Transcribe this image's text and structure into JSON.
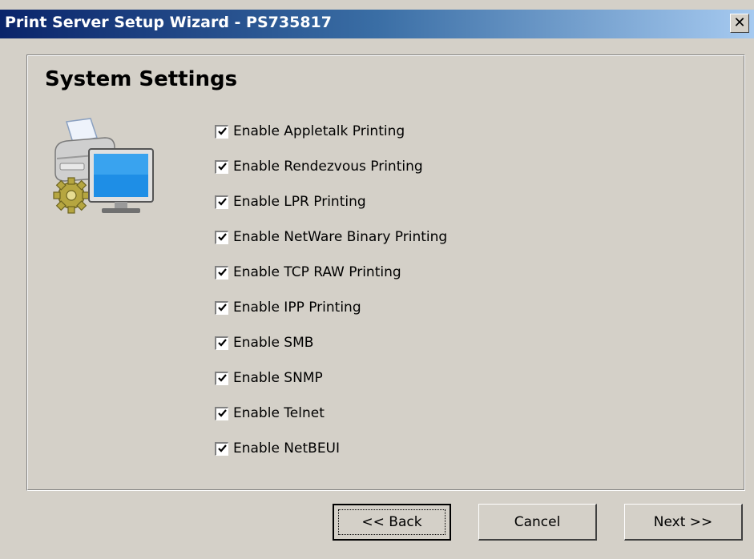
{
  "window": {
    "title": "Print Server Setup Wizard - PS735817",
    "close_glyph": "✕"
  },
  "page": {
    "heading": "System Settings",
    "illustration_icon": "printer-computer-gear-icon"
  },
  "options": [
    {
      "label": "Enable Appletalk Printing",
      "checked": true
    },
    {
      "label": "Enable Rendezvous Printing",
      "checked": true
    },
    {
      "label": "Enable LPR Printing",
      "checked": true
    },
    {
      "label": "Enable NetWare Binary Printing",
      "checked": true
    },
    {
      "label": "Enable TCP RAW Printing",
      "checked": true
    },
    {
      "label": "Enable IPP Printing",
      "checked": true
    },
    {
      "label": "Enable SMB",
      "checked": true
    },
    {
      "label": "Enable SNMP",
      "checked": true
    },
    {
      "label": "Enable Telnet",
      "checked": true
    },
    {
      "label": "Enable NetBEUI",
      "checked": true
    }
  ],
  "buttons": {
    "back": "<< Back",
    "cancel": "Cancel",
    "next": "Next >>"
  },
  "colors": {
    "dialog_bg": "#d4d0c8",
    "title_start": "#0a246a",
    "title_end": "#a6caf0"
  }
}
